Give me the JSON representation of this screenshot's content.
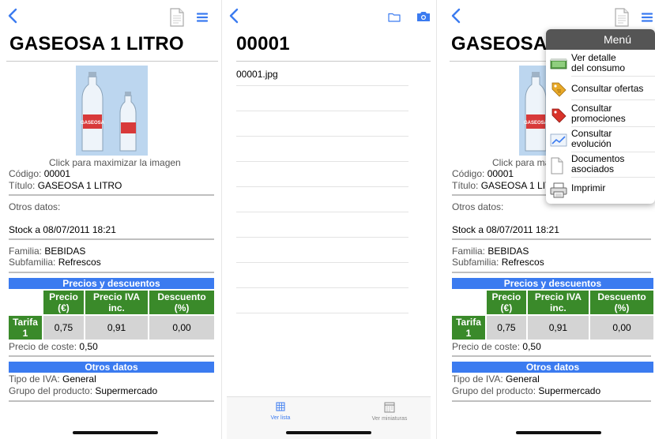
{
  "colors": {
    "accent": "#3b7bf0",
    "green": "#3a8a2a",
    "gray_cell": "#d4d4d4",
    "menu_header": "#555555"
  },
  "product": {
    "title": "GASEOSA 1 LITRO",
    "image_caption": "Click para maximizar la imagen",
    "codigo_label": "Código: ",
    "codigo_value": "00001",
    "titulo_label": "Título: ",
    "titulo_value": "GASEOSA 1 LITRO",
    "otros_datos_label": "Otros datos:",
    "stock": "Stock a 08/07/2011 18:21",
    "familia_label": "Familia: ",
    "familia_value": "BEBIDAS",
    "subfamilia_label": "Subfamilia: ",
    "subfamilia_value": "Refrescos",
    "precios_header": "Precios y descuentos",
    "price_headers": [
      "Precio\n(€)",
      "Precio IVA\ninc.",
      "Descuento\n(%)"
    ],
    "tarifa_label": "Tarifa\n1",
    "tarifa_values": [
      "0,75",
      "0,91",
      "0,00"
    ],
    "coste_label": "Precio de coste: ",
    "coste_value": "0,50",
    "otros_header": "Otros datos",
    "iva_label": "Tipo de IVA: ",
    "iva_value": "General",
    "grupo_label": "Grupo del producto: ",
    "grupo_value": "Supermercado",
    "bottle_label": "GASEOSA"
  },
  "files": {
    "title": "00001",
    "items": [
      "00001.jpg"
    ],
    "tab_list": "Ver lista",
    "tab_thumbs": "Ver miniaturas"
  },
  "menu": {
    "header": "Menú",
    "items": [
      {
        "label": "Ver detalle\ndel consumo",
        "icon": "money-icon"
      },
      {
        "label": "Consultar ofertas",
        "icon": "tag-icon"
      },
      {
        "label": "Consultar\npromociones",
        "icon": "promo-tag-icon"
      },
      {
        "label": "Consultar\nevolución",
        "icon": "chart-icon"
      },
      {
        "label": "Documentos\nasociados",
        "icon": "document-icon"
      },
      {
        "label": "Imprimir",
        "icon": "printer-icon"
      }
    ]
  }
}
